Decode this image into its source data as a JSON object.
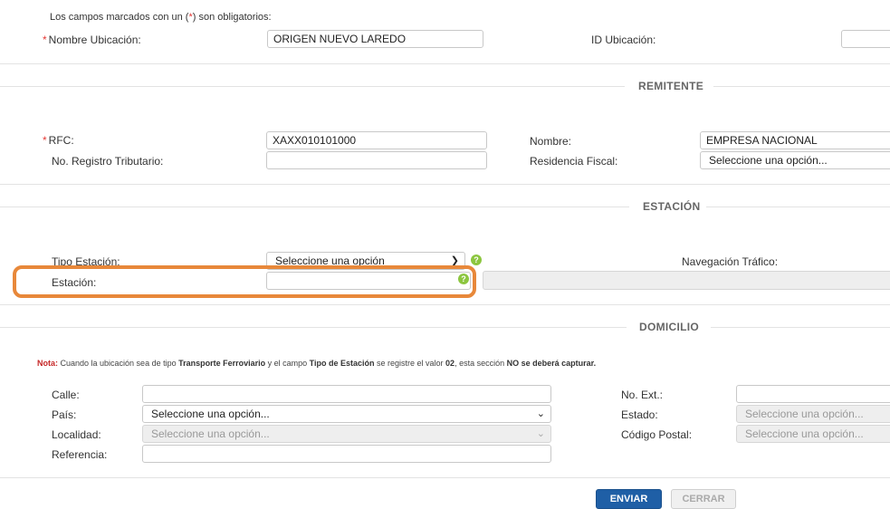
{
  "form": {
    "required_note_prefix": "Los campos marcados con un (",
    "required_note_star": "*",
    "required_note_suffix": ") son obligatorios:",
    "required_mark": "*",
    "nombre_ubicacion_label": "Nombre Ubicación:",
    "nombre_ubicacion_value": "ORIGEN NUEVO LAREDO",
    "id_ubicacion_label": "ID Ubicación:",
    "id_ubicacion_value": ""
  },
  "remitente": {
    "title": "REMITENTE",
    "rfc_label": "RFC:",
    "rfc_value": "XAXX010101000",
    "nombre_label": "Nombre:",
    "nombre_value": "EMPRESA NACIONAL",
    "registro_label": "No. Registro Tributario:",
    "registro_value": "",
    "residencia_label": "Residencia Fiscal:",
    "residencia_value": "Seleccione una opción..."
  },
  "estacion": {
    "title": "ESTACIÓN",
    "tipo_label": "Tipo Estación:",
    "tipo_value": "Seleccione una opción",
    "estacion_label": "Estación:",
    "estacion_value": "",
    "navegacion_label": "Navegación Tráfico:",
    "help_glyph": "?"
  },
  "domicilio": {
    "title": "DOMICILIO",
    "note_prefix": "Nota:",
    "note_text_1": " Cuando la ubicación sea de tipo ",
    "note_bold_1": "Transporte Ferroviario",
    "note_text_2": " y el campo ",
    "note_bold_2": "Tipo de Estación",
    "note_text_3": " se registre el valor ",
    "note_bold_3": "02",
    "note_text_4": ", esta sección ",
    "note_bold_4": "NO se deberá capturar.",
    "calle_label": "Calle:",
    "calle_value": "",
    "pais_label": "País:",
    "pais_value": "Seleccione una opción...",
    "localidad_label": "Localidad:",
    "localidad_value": "Seleccione una opción...",
    "referencia_label": "Referencia:",
    "referencia_value": "",
    "no_ext_label": "No. Ext.:",
    "no_ext_value": "",
    "estado_label": "Estado:",
    "estado_value": "Seleccione una opción...",
    "cp_label": "Código Postal:",
    "cp_value": "Seleccione una opción..."
  },
  "buttons": {
    "primary_label": "ENVIAR",
    "secondary_label": "CERRAR"
  },
  "colors": {
    "highlight": "#e8883a",
    "required": "#e53935",
    "help_icon": "#8cc63f",
    "primary_button": "#1f5fa6"
  }
}
